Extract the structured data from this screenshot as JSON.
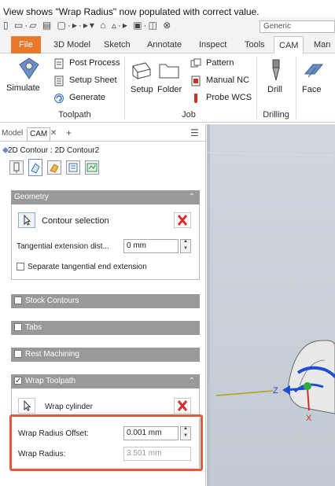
{
  "caption": "View shows \"Wrap Radius\" now populated with correct value.",
  "qat": {
    "glyphs": "▯ ▭·▱ ▤ ▢·▸·▸▾ ⌂ ▵·▸ ▣·◫ ⊗",
    "style_select": "Generic"
  },
  "tabs": [
    "File",
    "3D Model",
    "Sketch",
    "Annotate",
    "Inspect",
    "Tools",
    "CAM",
    "Man"
  ],
  "ribbon": {
    "simulate": "Simulate",
    "post_process": "Post Process",
    "setup_sheet": "Setup Sheet",
    "generate": "Generate",
    "toolpath_group": "Toolpath",
    "setup": "Setup",
    "folder": "Folder",
    "pattern": "Pattern",
    "manual_nc": "Manual NC",
    "probe_wcs": "Probe WCS",
    "job_group": "Job",
    "drill": "Drill",
    "drilling_group": "Drilling",
    "face": "Face"
  },
  "browser": {
    "tab_model": "Model",
    "tab_cam": "CAM",
    "close": "✕",
    "add": "+",
    "menu": "☰"
  },
  "breadcrumb": "2D Contour : 2D Contour2",
  "geometry": {
    "title": "Geometry",
    "contour_selection": "Contour selection",
    "tangential_label": "Tangential extension dist...",
    "tangential_value": "0 mm",
    "separate_label": "Separate tangential end extension"
  },
  "sections": {
    "stock_contours": "Stock Contours",
    "tabs": "Tabs",
    "rest_machining": "Rest Machining",
    "wrap_toolpath": "Wrap Toolpath"
  },
  "wrap": {
    "cylinder": "Wrap cylinder",
    "radius_offset_label": "Wrap Radius Offset:",
    "radius_offset_value": "0.001 mm",
    "radius_label": "Wrap Radius:",
    "radius_value": "3.501 mm"
  },
  "triad": {
    "z": "Z",
    "x": "X"
  },
  "colors": {
    "file_tab": "#e8792b",
    "highlight": "#e05a3f",
    "section_bar": "#999999",
    "delete_x": "#d32f2f"
  }
}
